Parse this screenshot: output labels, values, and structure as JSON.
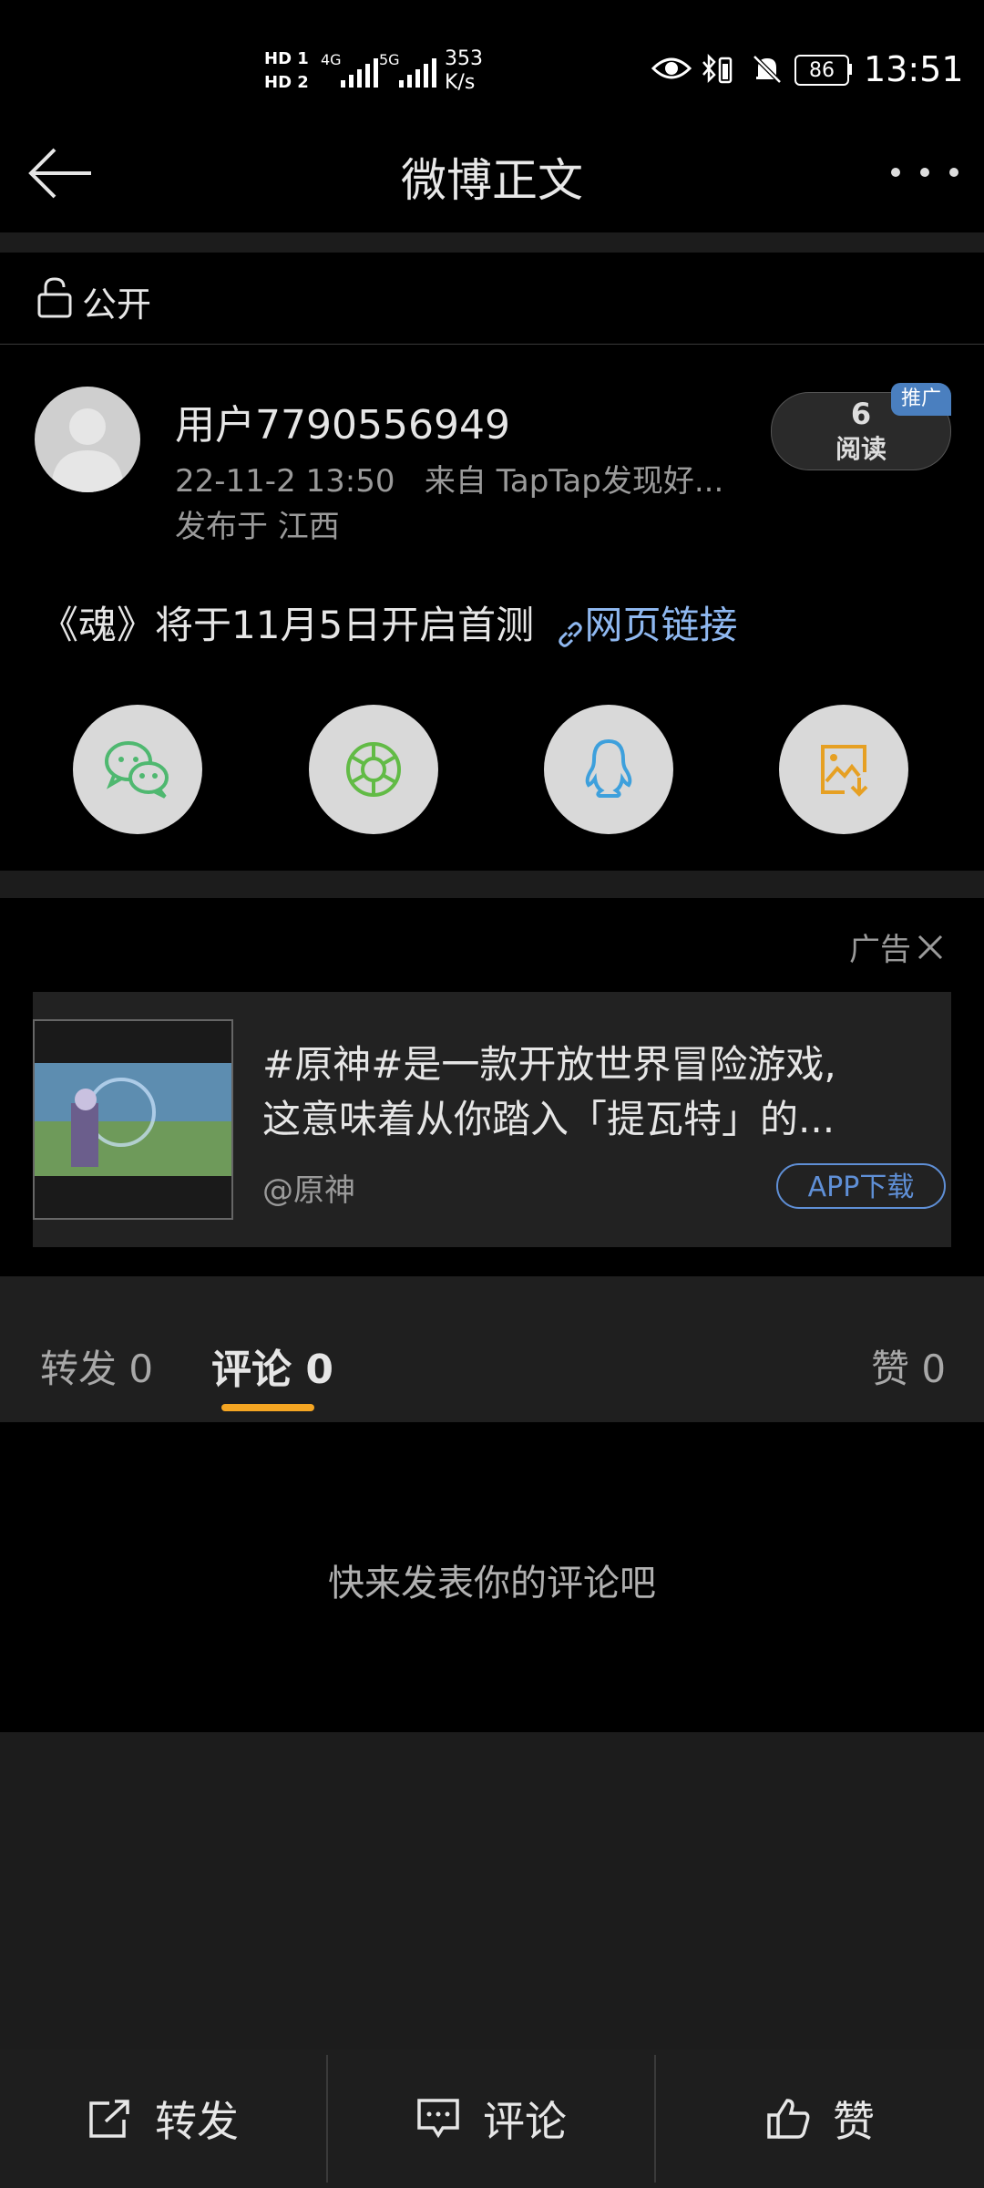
{
  "status": {
    "hd1": "HD 1",
    "hd2": "HD 2",
    "net1": "4G",
    "net2": "5G",
    "speed_value": "353",
    "speed_unit": "K/s",
    "battery": "86",
    "time": "13:51"
  },
  "header": {
    "title": "微博正文"
  },
  "visibility": {
    "label": "公开"
  },
  "post": {
    "username": "用户7790556949",
    "meta": "22-11-2 13:50   来自 TapTap发现好...",
    "location": "发布于 江西",
    "reads_count": "6",
    "reads_label": "阅读",
    "promo_badge": "推广",
    "content": "《魂》将于11月5日开启首测",
    "link_text": "网页链接"
  },
  "share": {
    "icons": [
      "wechat-icon",
      "moments-icon",
      "qq-icon",
      "save-image-icon"
    ]
  },
  "ad": {
    "label": "广告",
    "text_line1": "#原神#是一款开放世界冒险游戏,",
    "text_line2": "这意味着从你踏入「提瓦特」的...",
    "source": "@原神",
    "cta": "APP下载"
  },
  "tabs": {
    "repost": "转发 0",
    "comments": "评论 0",
    "likes": "赞 0"
  },
  "empty_state": "快来发表你的评论吧",
  "bottom_bar": {
    "repost": "转发",
    "comment": "评论",
    "like": "赞"
  },
  "colors": {
    "accent": "#f5a623",
    "link": "#8fb8f0",
    "ad_cta": "#5f8fd6",
    "wechat": "#4fb870",
    "moments": "#62bb46",
    "qq": "#3ea0dc",
    "save": "#e6a023"
  }
}
